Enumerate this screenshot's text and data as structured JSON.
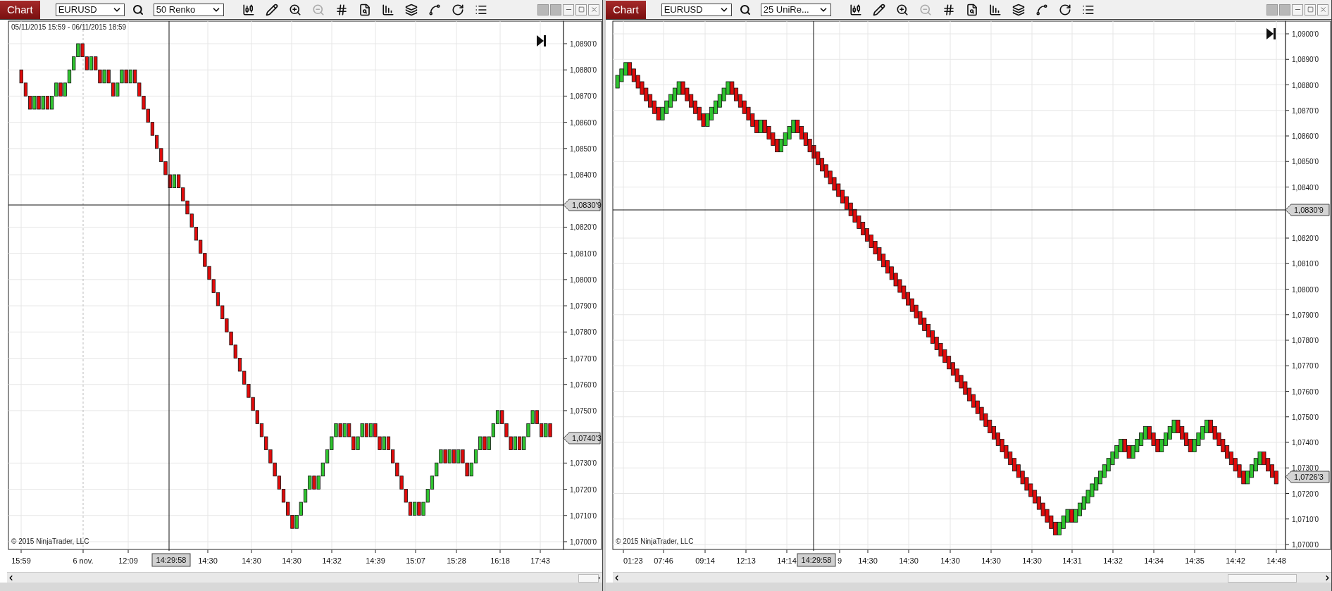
{
  "panels": [
    {
      "tab": "Chart",
      "instrument": "EURUSD",
      "bar_type": "50 Renko",
      "zoom_out": {
        "disabled": true
      },
      "date_range": "05/11/2015 15:59 - 06/11/2015 18:59",
      "price_ticks": [
        "1,0890'0",
        "1,0880'0",
        "1,0870'0",
        "1,0860'0",
        "1,0850'0",
        "1,0840'0",
        "1,0820'0",
        "1,0810'0",
        "1,0800'0",
        "1,0790'0",
        "1,0780'0",
        "1,0770'0",
        "1,0760'0",
        "1,0750'0",
        "1,0730'0",
        "1,0720'0",
        "1,0710'0",
        "1,0700'0"
      ],
      "crosshair_price": "1,0830'9",
      "last_price": "1,0740'3",
      "time_labels": [
        "15:59",
        "6 nov.",
        "12:09",
        "14:30",
        "14:30",
        "14:30",
        "14:32",
        "14:39",
        "15:07",
        "15:28",
        "16:18",
        "17:43"
      ],
      "crosshair_time": "14:29:58",
      "copyright": "© 2015 NinjaTrader, LLC"
    },
    {
      "tab": "Chart",
      "instrument": "EURUSD",
      "bar_type": "25 UniRe...",
      "zoom_out": {
        "disabled": true
      },
      "price_ticks": [
        "1,0900'0",
        "1,0890'0",
        "1,0880'0",
        "1,0870'0",
        "1,0860'0",
        "1,0850'0",
        "1,0840'0",
        "1,0820'0",
        "1,0810'0",
        "1,0800'0",
        "1,0790'0",
        "1,0780'0",
        "1,0770'0",
        "1,0760'0",
        "1,0750'0",
        "1,0740'0",
        "1,0730'0",
        "1,0720'0",
        "1,0710'0",
        "1,0700'0"
      ],
      "crosshair_price": "1,0830'9",
      "last_price": "1,0726'3",
      "time_labels": [
        "01:23",
        "07:46",
        "09:14",
        "12:13",
        "14:14",
        "9",
        "14:30",
        "14:30",
        "14:30",
        "14:30",
        "14:30",
        "14:31",
        "14:32",
        "14:34",
        "14:35",
        "14:42",
        "14:48"
      ],
      "crosshair_time": "14:29:58",
      "copyright": "© 2015 NinjaTrader, LLC"
    }
  ]
}
